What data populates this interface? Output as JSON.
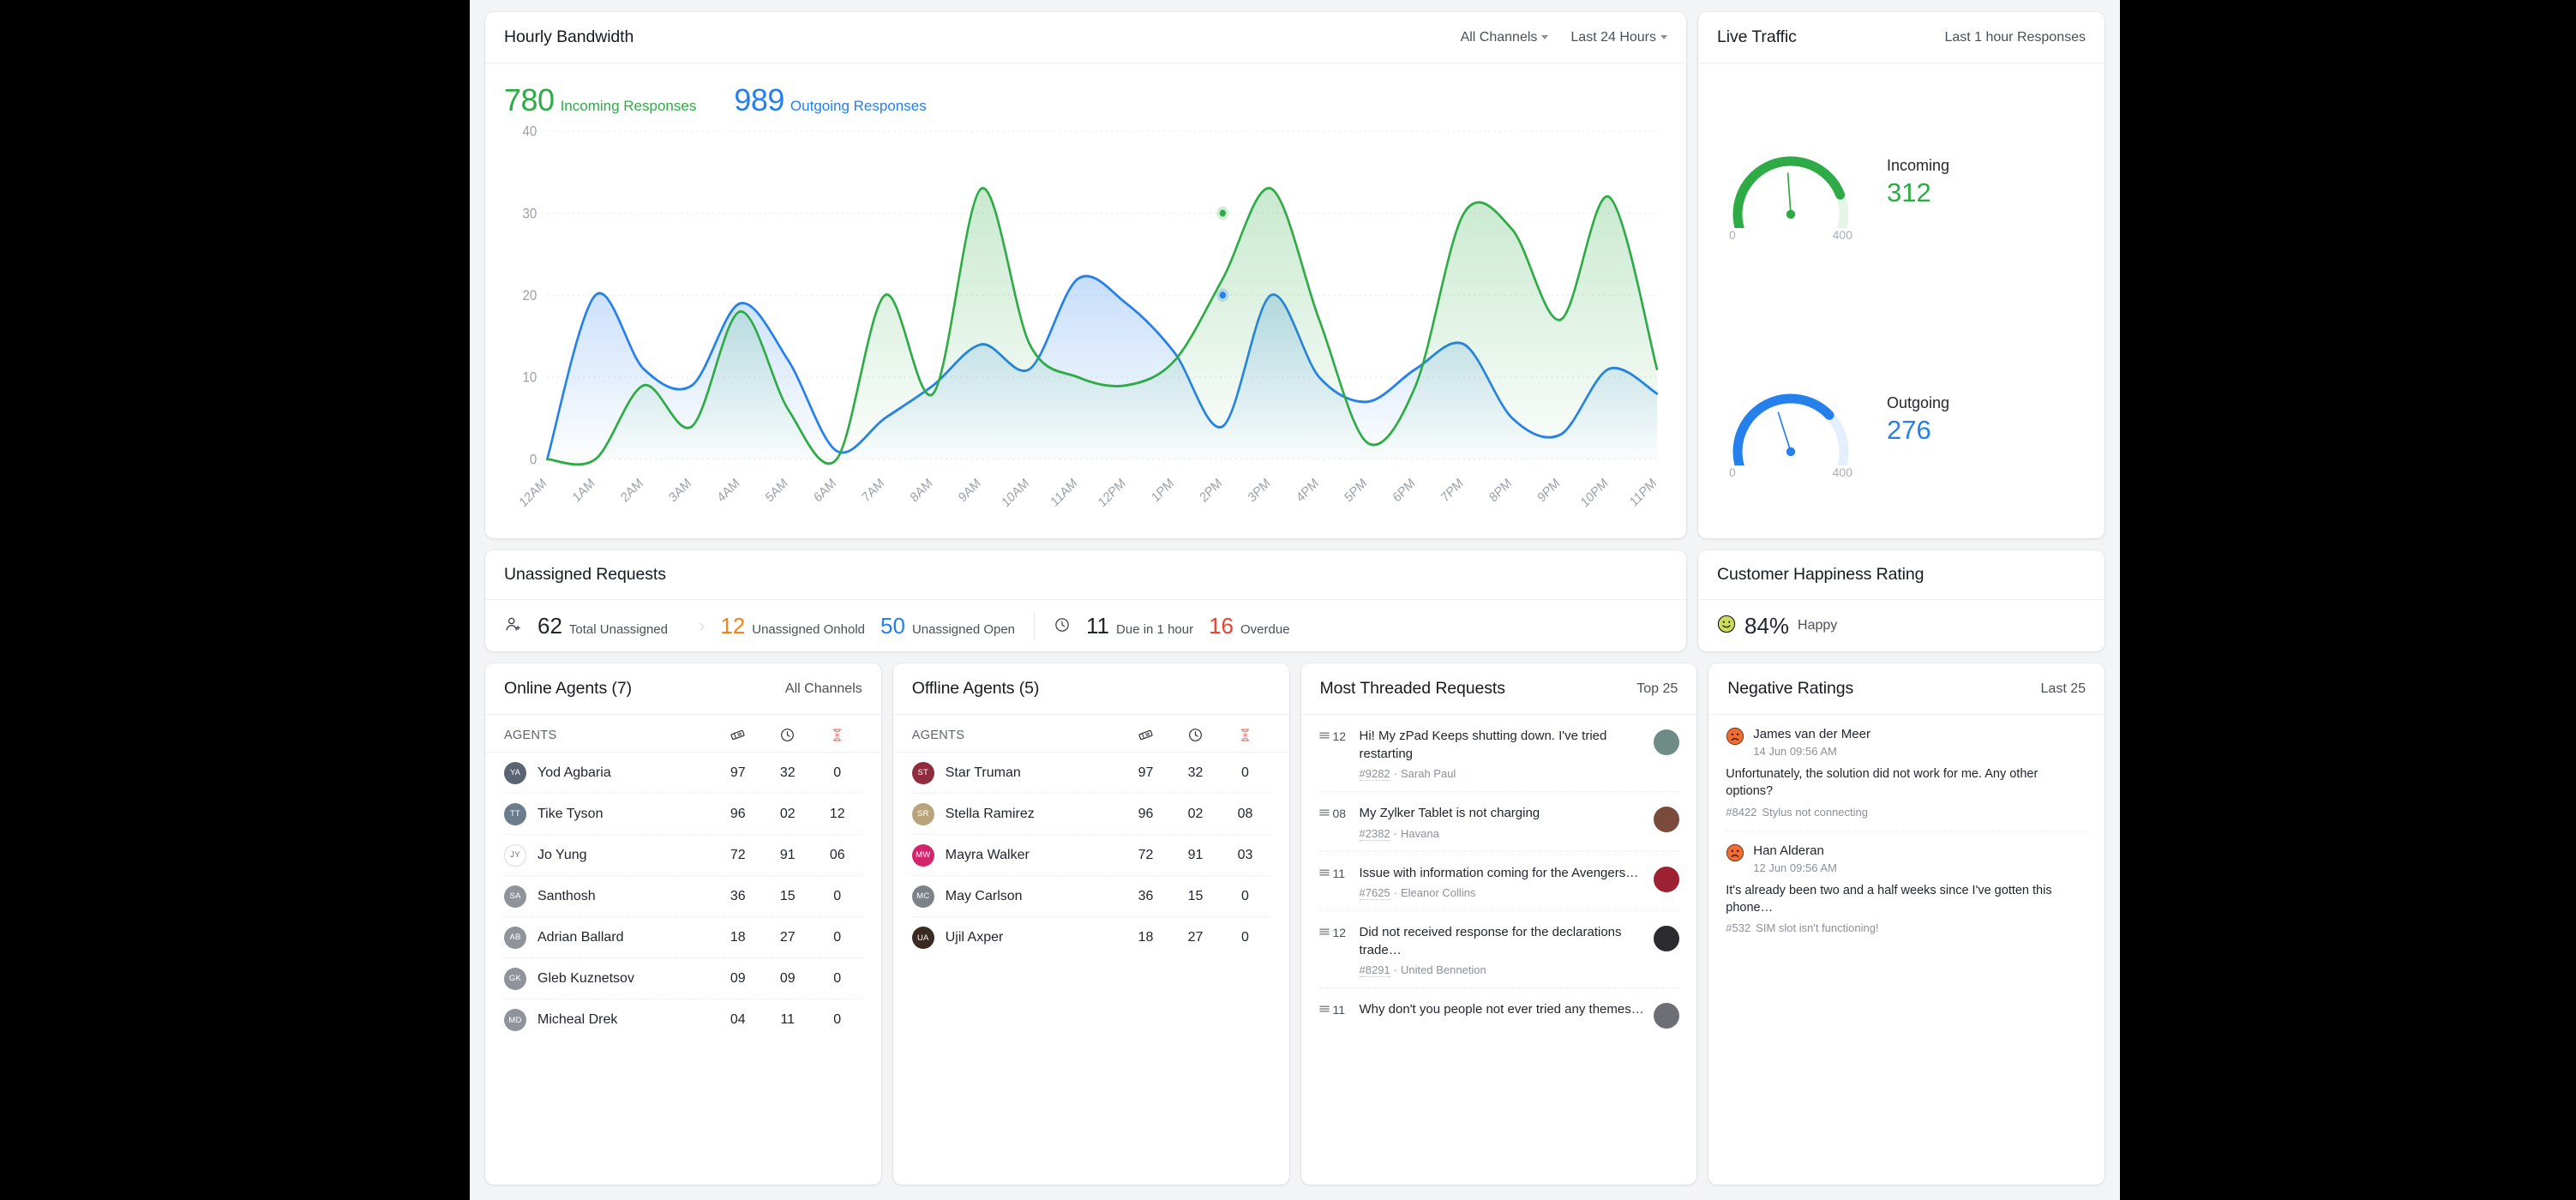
{
  "bandwidth": {
    "title": "Hourly Bandwidth",
    "filter_channels": "All Channels",
    "filter_range": "Last 24 Hours",
    "incoming_value": "780",
    "incoming_label": "Incoming Responses",
    "outgoing_value": "989",
    "outgoing_label": "Outgoing Responses"
  },
  "chart_data": {
    "type": "area",
    "title": "Hourly Bandwidth",
    "xlabel": "",
    "ylabel": "",
    "ylim": [
      0,
      40
    ],
    "yticks": [
      0,
      10,
      20,
      30,
      40
    ],
    "grid": true,
    "legend_position": "top-left",
    "categories": [
      "12AM",
      "1AM",
      "2AM",
      "3AM",
      "4AM",
      "5AM",
      "6AM",
      "7AM",
      "8AM",
      "9AM",
      "10AM",
      "11AM",
      "12PM",
      "1PM",
      "2PM",
      "3PM",
      "4PM",
      "5PM",
      "6PM",
      "7PM",
      "8PM",
      "9PM",
      "10PM",
      "11PM"
    ],
    "series": [
      {
        "name": "Incoming Responses",
        "color": "#2eab46",
        "total": 780,
        "values": [
          0,
          0,
          9,
          4,
          18,
          6,
          0,
          20,
          8,
          33,
          14,
          10,
          9,
          12,
          22,
          33,
          17,
          2,
          9,
          30,
          28,
          17,
          32,
          11
        ]
      },
      {
        "name": "Outgoing Responses",
        "color": "#2680eb",
        "total": 989,
        "values": [
          0,
          20,
          11,
          9,
          19,
          12,
          1,
          5,
          9,
          14,
          11,
          22,
          19,
          13,
          4,
          20,
          10,
          7,
          11,
          14,
          5,
          3,
          11,
          8
        ]
      }
    ],
    "markers": [
      {
        "series": "Incoming Responses",
        "x": "2PM",
        "y": 30
      },
      {
        "series": "Outgoing Responses",
        "x": "2PM",
        "y": 20
      }
    ]
  },
  "live_traffic": {
    "title": "Live Traffic",
    "range_label": "Last 1 hour Responses",
    "gauges": [
      {
        "label": "Incoming",
        "value": "312",
        "min": "0",
        "max": "400",
        "color": "#2eab46",
        "pct": 0.78
      },
      {
        "label": "Outgoing",
        "value": "276",
        "min": "0",
        "max": "400",
        "color": "#2680eb",
        "pct": 0.69
      }
    ]
  },
  "unassigned": {
    "title": "Unassigned Requests",
    "metrics": [
      {
        "icon": "user-plus-icon",
        "value": "62",
        "label": "Total Unassigned",
        "tone": "plain"
      },
      {
        "icon": "",
        "value": "12",
        "label": "Unassigned Onhold",
        "tone": "orange"
      },
      {
        "icon": "",
        "value": "50",
        "label": "Unassigned Open",
        "tone": "blue"
      },
      {
        "icon": "clock-icon",
        "value": "11",
        "label": "Due in 1 hour",
        "tone": "plain"
      },
      {
        "icon": "",
        "value": "16",
        "label": "Overdue",
        "tone": "red"
      }
    ]
  },
  "happiness": {
    "title": "Customer Happiness Rating",
    "percent": "84%",
    "label": "Happy"
  },
  "online_agents": {
    "title": "Online Agents (7)",
    "filter": "All Channels",
    "col_agents": "AGENTS",
    "columns": [
      "ticket-icon",
      "clock-icon",
      "hourglass-icon"
    ],
    "rows": [
      {
        "name": "Yod Agbaria",
        "initials": "YA",
        "v1": "97",
        "v2": "32",
        "v3": "0",
        "av": "#5a6473"
      },
      {
        "name": "Tike Tyson",
        "initials": "TT",
        "v1": "96",
        "v2": "02",
        "v3": "12",
        "av": "#6b7c8c"
      },
      {
        "name": "Jo Yung",
        "initials": "JY",
        "v1": "72",
        "v2": "91",
        "v3": "06",
        "av": ""
      },
      {
        "name": "Santhosh",
        "initials": "SA",
        "v1": "36",
        "v2": "15",
        "v3": "0",
        "av": "#8f949b"
      },
      {
        "name": "Adrian Ballard",
        "initials": "AB",
        "v1": "18",
        "v2": "27",
        "v3": "0",
        "av": "#8f949b"
      },
      {
        "name": "Gleb Kuznetsov",
        "initials": "GK",
        "v1": "09",
        "v2": "09",
        "v3": "0",
        "av": "#8f949b"
      },
      {
        "name": "Micheal Drek",
        "initials": "MD",
        "v1": "04",
        "v2": "11",
        "v3": "0",
        "av": "#8f949b"
      }
    ]
  },
  "offline_agents": {
    "title": "Offline Agents (5)",
    "col_agents": "AGENTS",
    "columns": [
      "ticket-icon",
      "clock-icon",
      "hourglass-icon"
    ],
    "rows": [
      {
        "name": "Star Truman",
        "initials": "ST",
        "v1": "97",
        "v2": "32",
        "v3": "0",
        "av": "#8e2b3d"
      },
      {
        "name": "Stella Ramirez",
        "initials": "SR",
        "v1": "96",
        "v2": "02",
        "v3": "08",
        "av": "#b9a37a"
      },
      {
        "name": "Mayra Walker",
        "initials": "MW",
        "v1": "72",
        "v2": "91",
        "v3": "03",
        "av": "#d4246b"
      },
      {
        "name": "May Carlson",
        "initials": "MC",
        "v1": "36",
        "v2": "15",
        "v3": "0",
        "av": "#7b8288"
      },
      {
        "name": "Ujil Axper",
        "initials": "UA",
        "v1": "18",
        "v2": "27",
        "v3": "0",
        "av": "#3a2a22"
      }
    ]
  },
  "threaded": {
    "title": "Most Threaded Requests",
    "filter": "Top 25",
    "rows": [
      {
        "count": "12",
        "subject": "Hi! My zPad Keeps shutting down. I've tried restarting",
        "id": "#9282",
        "author": "Sarah Paul",
        "av": "#6e8b86"
      },
      {
        "count": "08",
        "subject": "My Zylker Tablet is not charging",
        "id": "#2382",
        "author": "Havana",
        "av": "#7a4a3c"
      },
      {
        "count": "11",
        "subject": "Issue with information coming for the Avengers…",
        "id": "#7625",
        "author": "Eleanor Collins",
        "av": "#9c2233"
      },
      {
        "count": "12",
        "subject": "Did not received response  for the declarations trade…",
        "id": "#8291",
        "author": "United Bennetion",
        "av": "#2c2c2e"
      },
      {
        "count": "11",
        "subject": "Why don't you people not ever tried any themes…",
        "id": "",
        "author": "",
        "av": "#6d6f74"
      }
    ]
  },
  "negative": {
    "title": "Negative Ratings",
    "filter": "Last 25",
    "rows": [
      {
        "name": "James van der Meer",
        "time": "14 Jun 09:56 AM",
        "text": "Unfortunately, the solution did not work for me. Any other options?",
        "id": "#8422",
        "subject": "Stylus not connecting"
      },
      {
        "name": "Han Alderan",
        "time": "12 Jun 09:56 AM",
        "text": "It's already been two and a half weeks since I've gotten this phone…",
        "id": "#532",
        "subject": "SIM slot isn't functioning!"
      }
    ]
  }
}
